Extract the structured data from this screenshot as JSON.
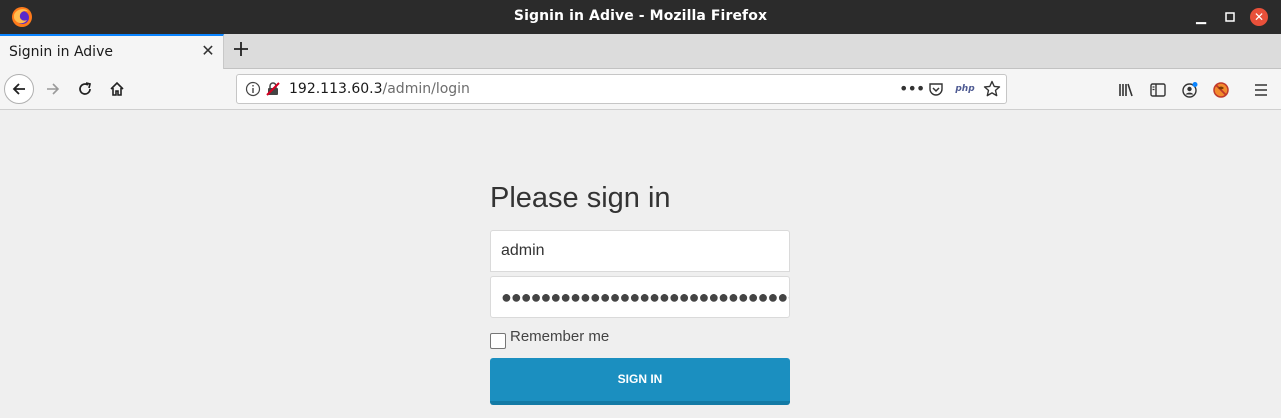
{
  "window": {
    "title": "Signin in Adive - Mozilla Firefox"
  },
  "tabs": [
    {
      "title": "Signin in Adive",
      "active": true
    }
  ],
  "urlbar": {
    "host": "192.113.60.3",
    "path": "/admin/login",
    "php_badge": "php"
  },
  "login": {
    "heading": "Please sign in",
    "username_value": "admin",
    "password_mask": "●●●●●●●●●●●●●●●●●●●●●●●●●●●●●●●●",
    "remember_label": "Remember me",
    "remember_checked": false,
    "signin_label": "SIGN IN"
  },
  "colors": {
    "titlebar_bg": "#2b2b2b",
    "page_bg": "#efefef",
    "button_bg": "#1b8fc0",
    "close_button": "#e8503a",
    "tab_accent": "#0a84ff"
  }
}
